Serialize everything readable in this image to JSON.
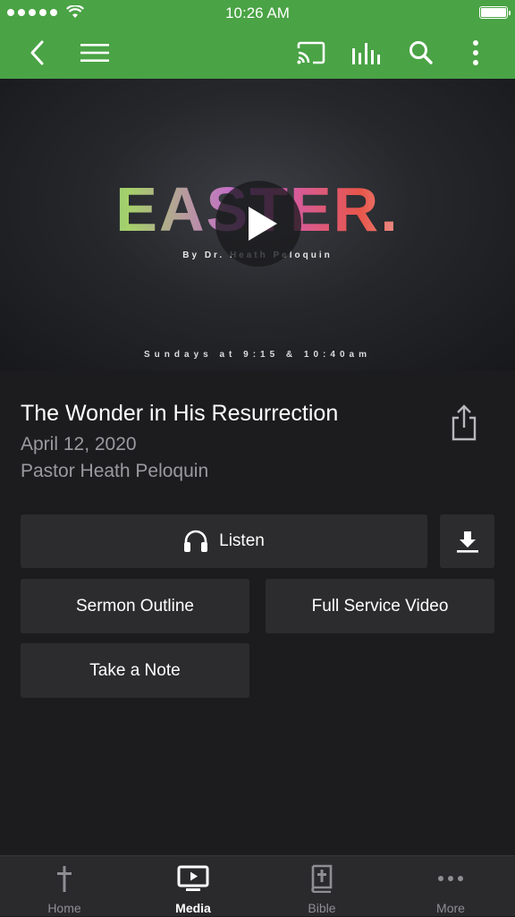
{
  "status_bar": {
    "time": "10:26 AM",
    "signal_dots": 5
  },
  "nav": {
    "back_icon": "chevron-left-icon",
    "menu_icon": "hamburger-menu-icon",
    "cast_icon": "cast-icon",
    "equalizer_icon": "equalizer-icon",
    "search_icon": "search-icon",
    "more_icon": "vertical-dots-icon"
  },
  "hero": {
    "title": "EASTER.",
    "byline": "By Dr. Heath Peloquin",
    "schedule": "Sundays at 9:15 & 10:40am",
    "play_icon": "play-icon"
  },
  "sermon": {
    "title": "The Wonder in His Resurrection",
    "date": "April 12, 2020",
    "speaker": "Pastor Heath Peloquin",
    "share_icon": "share-icon"
  },
  "actions": {
    "listen_label": "Listen",
    "listen_icon": "headphones-icon",
    "download_icon": "download-icon",
    "outline_label": "Sermon Outline",
    "video_label": "Full Service Video",
    "note_label": "Take a Note"
  },
  "tabs": [
    {
      "label": "Home",
      "icon": "cross-icon",
      "active": false
    },
    {
      "label": "Media",
      "icon": "tv-play-icon",
      "active": true
    },
    {
      "label": "Bible",
      "icon": "bible-icon",
      "active": false
    },
    {
      "label": "More",
      "icon": "horizontal-dots-icon",
      "active": false
    }
  ],
  "colors": {
    "accent": "#4aa345",
    "background": "#1c1c1e",
    "button": "#2c2c2e",
    "secondary_text": "#9a9a9f"
  }
}
